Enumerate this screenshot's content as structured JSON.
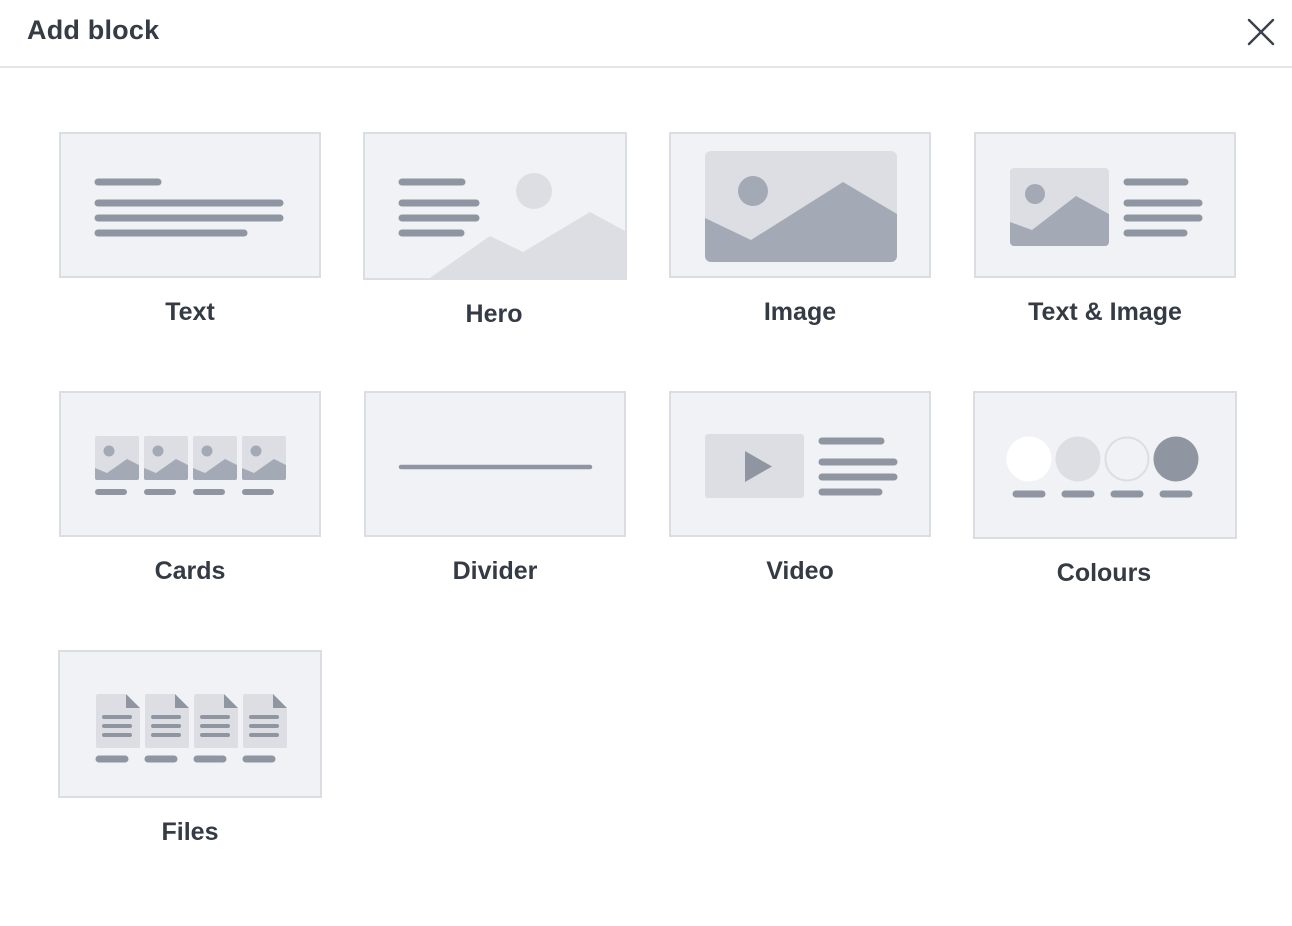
{
  "dialog": {
    "title": "Add block",
    "close_icon": "close-icon"
  },
  "blocks": [
    {
      "label": "Text",
      "icon": "text-block-icon"
    },
    {
      "label": "Hero",
      "icon": "hero-block-icon"
    },
    {
      "label": "Image",
      "icon": "image-block-icon"
    },
    {
      "label": "Text & Image",
      "icon": "text-image-block-icon"
    },
    {
      "label": "Cards",
      "icon": "cards-block-icon"
    },
    {
      "label": "Divider",
      "icon": "divider-block-icon"
    },
    {
      "label": "Video",
      "icon": "video-block-icon"
    },
    {
      "label": "Colours",
      "icon": "colours-block-icon"
    },
    {
      "label": "Files",
      "icon": "files-block-icon"
    }
  ],
  "colors": {
    "thumb_bg": "#f1f2f5",
    "thumb_border": "#dadde2",
    "placeholder_dark": "#8f96a1",
    "placeholder_mid": "#a4aab5",
    "placeholder_light": "#dcdee3"
  }
}
